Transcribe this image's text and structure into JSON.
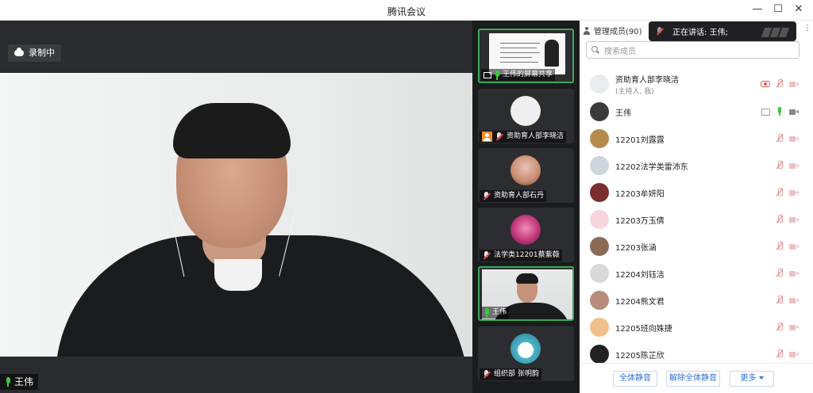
{
  "window": {
    "title": "腾讯会议",
    "controls": [
      "minimize-icon",
      "maximize-icon",
      "close-icon"
    ]
  },
  "main_video": {
    "recording_label": "录制中",
    "speaker_name": "王伟"
  },
  "thumbnails": [
    {
      "label": "王伟的屏幕共享",
      "type": "screen-share",
      "mic": "on"
    },
    {
      "label": "资助育人部李晓洁",
      "type": "avatar",
      "mic": "muted",
      "host": true,
      "avatar_color": "#efefef"
    },
    {
      "label": "资助育人部石丹",
      "type": "avatar",
      "mic": "muted",
      "avatar_color": "#c98b72"
    },
    {
      "label": "法学类12201蔡紫薇",
      "type": "avatar",
      "mic": "muted",
      "avatar_color": "#c2377a"
    },
    {
      "label": "王伟",
      "type": "camera",
      "mic": "on"
    },
    {
      "label": "组织部 张明韵",
      "type": "avatar",
      "mic": "muted",
      "avatar_color": "#4fb5c9"
    }
  ],
  "panel": {
    "title": "管理成员(90)",
    "speaking_label": "正在讲话: 王伟;",
    "search_placeholder": "搜索成员",
    "members": [
      {
        "name": "资助育人部李晓洁",
        "sub": "(主持人, 我)",
        "avatar_color": "#e8ecec",
        "icons": [
          "rec",
          "mic-off",
          "cam-off"
        ]
      },
      {
        "name": "王伟",
        "sub": "",
        "avatar_color": "#3b3b3b",
        "icons": [
          "share",
          "mic-on",
          "cam-on"
        ]
      },
      {
        "name": "12201刘露露",
        "sub": "",
        "avatar_color": "#b58b4c",
        "icons": [
          "mic-off",
          "cam-off"
        ]
      },
      {
        "name": "12202法学类雷沛东",
        "sub": "",
        "avatar_color": "#cfd6dd",
        "icons": [
          "mic-off",
          "cam-off"
        ]
      },
      {
        "name": "12203牟妍阳",
        "sub": "",
        "avatar_color": "#7a2e2e",
        "icons": [
          "mic-off",
          "cam-off"
        ]
      },
      {
        "name": "12203万玉倩",
        "sub": "",
        "avatar_color": "#f4d6dc",
        "icons": [
          "mic-off",
          "cam-off"
        ]
      },
      {
        "name": "12203张涵",
        "sub": "",
        "avatar_color": "#8a6a55",
        "icons": [
          "mic-off",
          "cam-off"
        ]
      },
      {
        "name": "12204刘钰洁",
        "sub": "",
        "avatar_color": "#d9d9d9",
        "icons": [
          "mic-off",
          "cam-off"
        ]
      },
      {
        "name": "12204熊文君",
        "sub": "",
        "avatar_color": "#b78c7a",
        "icons": [
          "mic-off",
          "cam-off"
        ]
      },
      {
        "name": "12205班向姝捷",
        "sub": "",
        "avatar_color": "#f2c08a",
        "icons": [
          "mic-off",
          "cam-off"
        ]
      },
      {
        "name": "12205陈芷欣",
        "sub": "",
        "avatar_color": "#222222",
        "icons": [
          "mic-off",
          "cam-off"
        ]
      }
    ],
    "buttons": {
      "mute_all": "全体静音",
      "unmute_all": "解除全体静音",
      "more": "更多"
    }
  },
  "colors": {
    "active_border": "#3aa85c",
    "link_blue": "#2f6fd6",
    "mic_green": "#3ac93a"
  }
}
